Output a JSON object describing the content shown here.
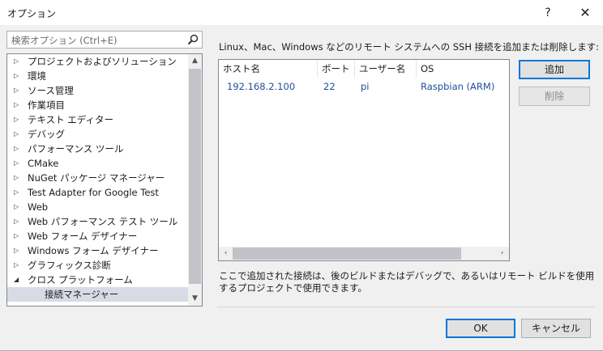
{
  "window": {
    "title": "オプション",
    "help_label": "?",
    "close_label": "✕"
  },
  "search": {
    "placeholder": "検索オプション (Ctrl+E)",
    "icon": "search-icon"
  },
  "tree": {
    "items": [
      {
        "label": "プロジェクトおよびソリューション",
        "expanded": false
      },
      {
        "label": "環境",
        "expanded": false
      },
      {
        "label": "ソース管理",
        "expanded": false
      },
      {
        "label": "作業項目",
        "expanded": false
      },
      {
        "label": "テキスト エディター",
        "expanded": false
      },
      {
        "label": "デバッグ",
        "expanded": false
      },
      {
        "label": "パフォーマンス ツール",
        "expanded": false
      },
      {
        "label": "CMake",
        "expanded": false
      },
      {
        "label": "NuGet パッケージ マネージャー",
        "expanded": false
      },
      {
        "label": "Test Adapter for Google Test",
        "expanded": false
      },
      {
        "label": "Web",
        "expanded": false
      },
      {
        "label": "Web パフォーマンス テスト ツール",
        "expanded": false
      },
      {
        "label": "Web フォーム デザイナー",
        "expanded": false
      },
      {
        "label": "Windows フォーム デザイナー",
        "expanded": false
      },
      {
        "label": "グラフィックス診断",
        "expanded": false
      },
      {
        "label": "クロス プラットフォーム",
        "expanded": true
      },
      {
        "label": "接続マネージャー",
        "child": true,
        "selected": true
      }
    ]
  },
  "main": {
    "description": "Linux、Mac、Windows などのリモート システムへの SSH 接続を追加または削除します:",
    "columns": [
      "ホスト名",
      "ポート",
      "ユーザー名",
      "OS"
    ],
    "rows": [
      {
        "host": "192.168.2.100",
        "port": "22",
        "user": "pi",
        "os": "Raspbian (ARM)"
      }
    ],
    "add_button": "追加",
    "remove_button": "削除",
    "note": "ここで追加された接続は、後のビルドまたはデバッグで、あるいはリモート ビルドを使用するプロジェクトで使用できます。"
  },
  "footer": {
    "ok": "OK",
    "cancel": "キャンセル"
  },
  "colors": {
    "accent": "#0078d7",
    "cell_text": "#1f4e9c",
    "selected_row": "#d8dbe6"
  }
}
